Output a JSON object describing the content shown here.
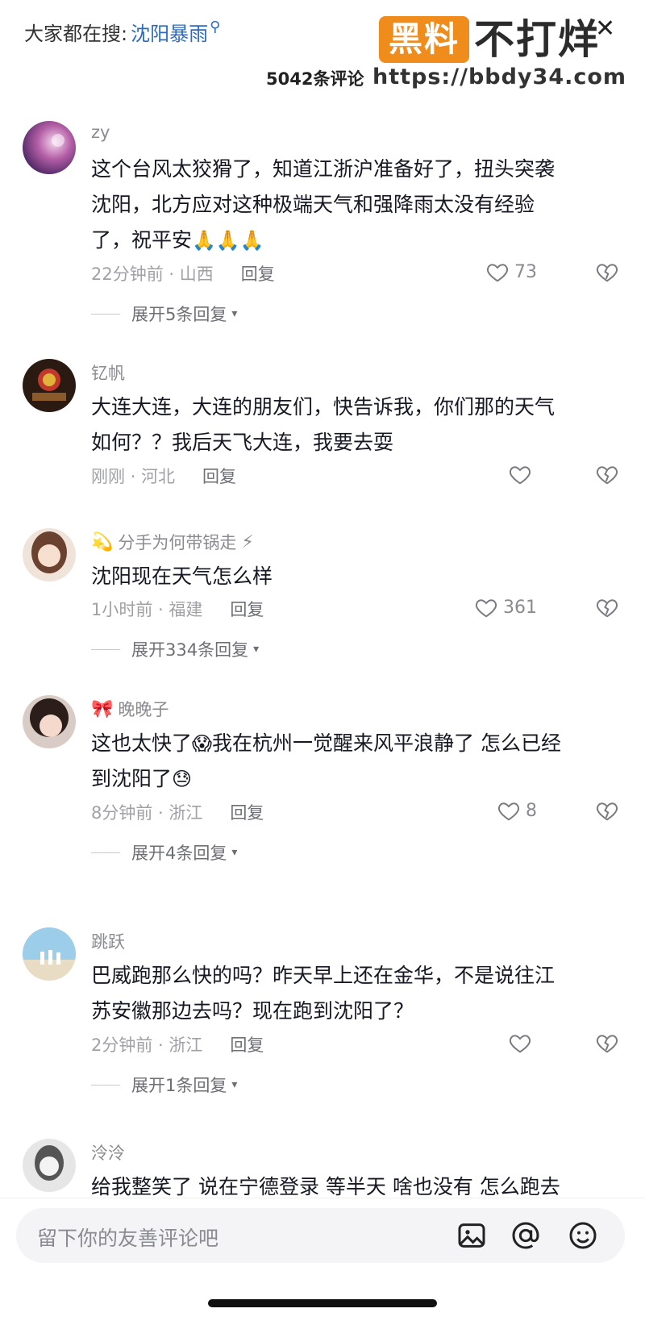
{
  "header": {
    "search_prefix": "大家都在搜:",
    "search_keyword": "沈阳暴雨",
    "comment_count": "5042条评论"
  },
  "watermark": {
    "logo_text": "黑料",
    "title": "不打烊",
    "url": "https://bbdy34.com"
  },
  "comments": [
    {
      "username": "zy",
      "text_lines": [
        "这个台风太狡猾了，知道江浙沪准备好了，扭头突袭",
        "沈阳，北方应对这种极端天气和强降雨太没有经验",
        "了，祝平安"
      ],
      "emoji": "🙏🙏🙏",
      "time_location": "22分钟前 · 山西",
      "reply_label": "回复",
      "likes": "73",
      "expand_label": "展开5条回复"
    },
    {
      "username": "钇帆",
      "text_lines": [
        "大连大连，大连的朋友们，快告诉我，你们那的天气",
        "如何？？我后天飞大连，我要去耍"
      ],
      "time_location": "刚刚 · 河北",
      "reply_label": "回复",
      "likes": ""
    },
    {
      "username": "分手为何带锅走",
      "username_prefix": "💫",
      "username_suffix": "⚡",
      "text_lines": [
        "沈阳现在天气怎么样"
      ],
      "time_location": "1小时前 · 福建",
      "reply_label": "回复",
      "likes": "361",
      "expand_label": "展开334条回复"
    },
    {
      "username": "晚晚子",
      "username_prefix": "🎀",
      "text_parts": [
        "这也太快了",
        "😱",
        "我在杭州一觉醒来风平浪静了 怎么已经"
      ],
      "text_line2": "到沈阳了",
      "emoji2": "😓",
      "time_location": "8分钟前 · 浙江",
      "reply_label": "回复",
      "likes": "8",
      "expand_label": "展开4条回复"
    },
    {
      "username": "跳跃",
      "text_lines": [
        "巴威跑那么快的吗？昨天早上还在金华，不是说往江",
        "苏安徽那边去吗？现在跑到沈阳了？"
      ],
      "time_location": "2分钟前 · 浙江",
      "reply_label": "回复",
      "likes": "",
      "expand_label": "展开1条回复"
    },
    {
      "username": "泠泠",
      "text_lines": [
        "给我整笑了 说在宁德登录 等半天 啥也没有 怎么跑去"
      ]
    }
  ],
  "bottom_bar": {
    "placeholder": "留下你的友善评论吧",
    "icons": [
      "image-icon",
      "at-icon",
      "emoji-icon"
    ]
  },
  "colors": {
    "keyword": "#2c6bbf",
    "watermark_orange": "#f08c1c",
    "meta_gray": "#a0a1a6"
  }
}
